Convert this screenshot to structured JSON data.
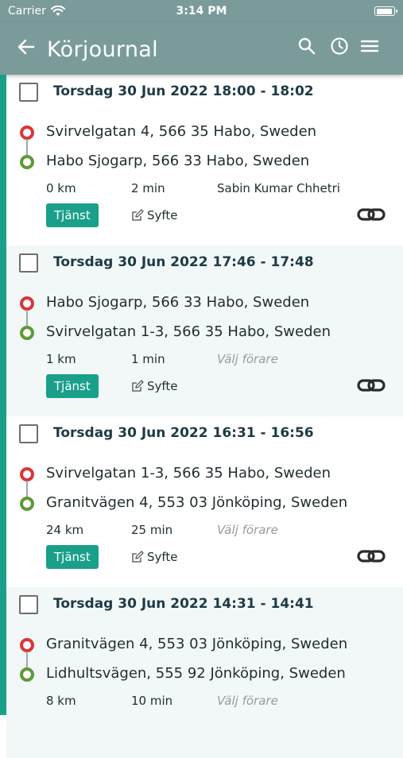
{
  "status_bar": {
    "carrier": "Carrier",
    "time": "3:14 PM"
  },
  "header": {
    "title": "Körjournal",
    "icons": [
      "back-arrow-icon",
      "search-icon",
      "clock-icon",
      "menu-icon"
    ]
  },
  "colors": {
    "header_bg": "#7a9b9a",
    "accent": "#1a9f8a",
    "start_pin": "#d9373a",
    "end_pin": "#5e9a37",
    "date_text": "#1e3a45"
  },
  "trips": [
    {
      "date": "Torsdag 30 Jun 2022 18:00 - 18:02",
      "start": "Svirvelgatan 4, 566 35 Habo, Sweden",
      "end": "Habo Sjogarp, 566 33 Habo, Sweden",
      "distance": "0 km",
      "duration": "2 min",
      "driver": "Sabin Kumar Chhetri",
      "tag": "Tjänst",
      "purpose": "Syfte"
    },
    {
      "date": "Torsdag 30 Jun 2022 17:46 - 17:48",
      "start": "Habo Sjogarp, 566 33 Habo, Sweden",
      "end": "Svirvelgatan 1-3, 566 35 Habo, Sweden",
      "distance": "1 km",
      "duration": "1 min",
      "driver": "Välj förare",
      "tag": "Tjänst",
      "purpose": "Syfte"
    },
    {
      "date": "Torsdag 30 Jun 2022 16:31 - 16:56",
      "start": "Svirvelgatan 1-3, 566 35 Habo, Sweden",
      "end": "Granitvägen 4, 553 03 Jönköping, Sweden",
      "distance": "24 km",
      "duration": "25 min",
      "driver": "Välj förare",
      "tag": "Tjänst",
      "purpose": "Syfte"
    },
    {
      "date": "Torsdag 30 Jun 2022 14:31 - 14:41",
      "start": "Granitvägen 4, 553 03 Jönköping, Sweden",
      "end": "Lidhultsvägen, 555 92 Jönköping, Sweden",
      "distance": "8 km",
      "duration": "10 min",
      "driver": "Välj förare"
    }
  ]
}
